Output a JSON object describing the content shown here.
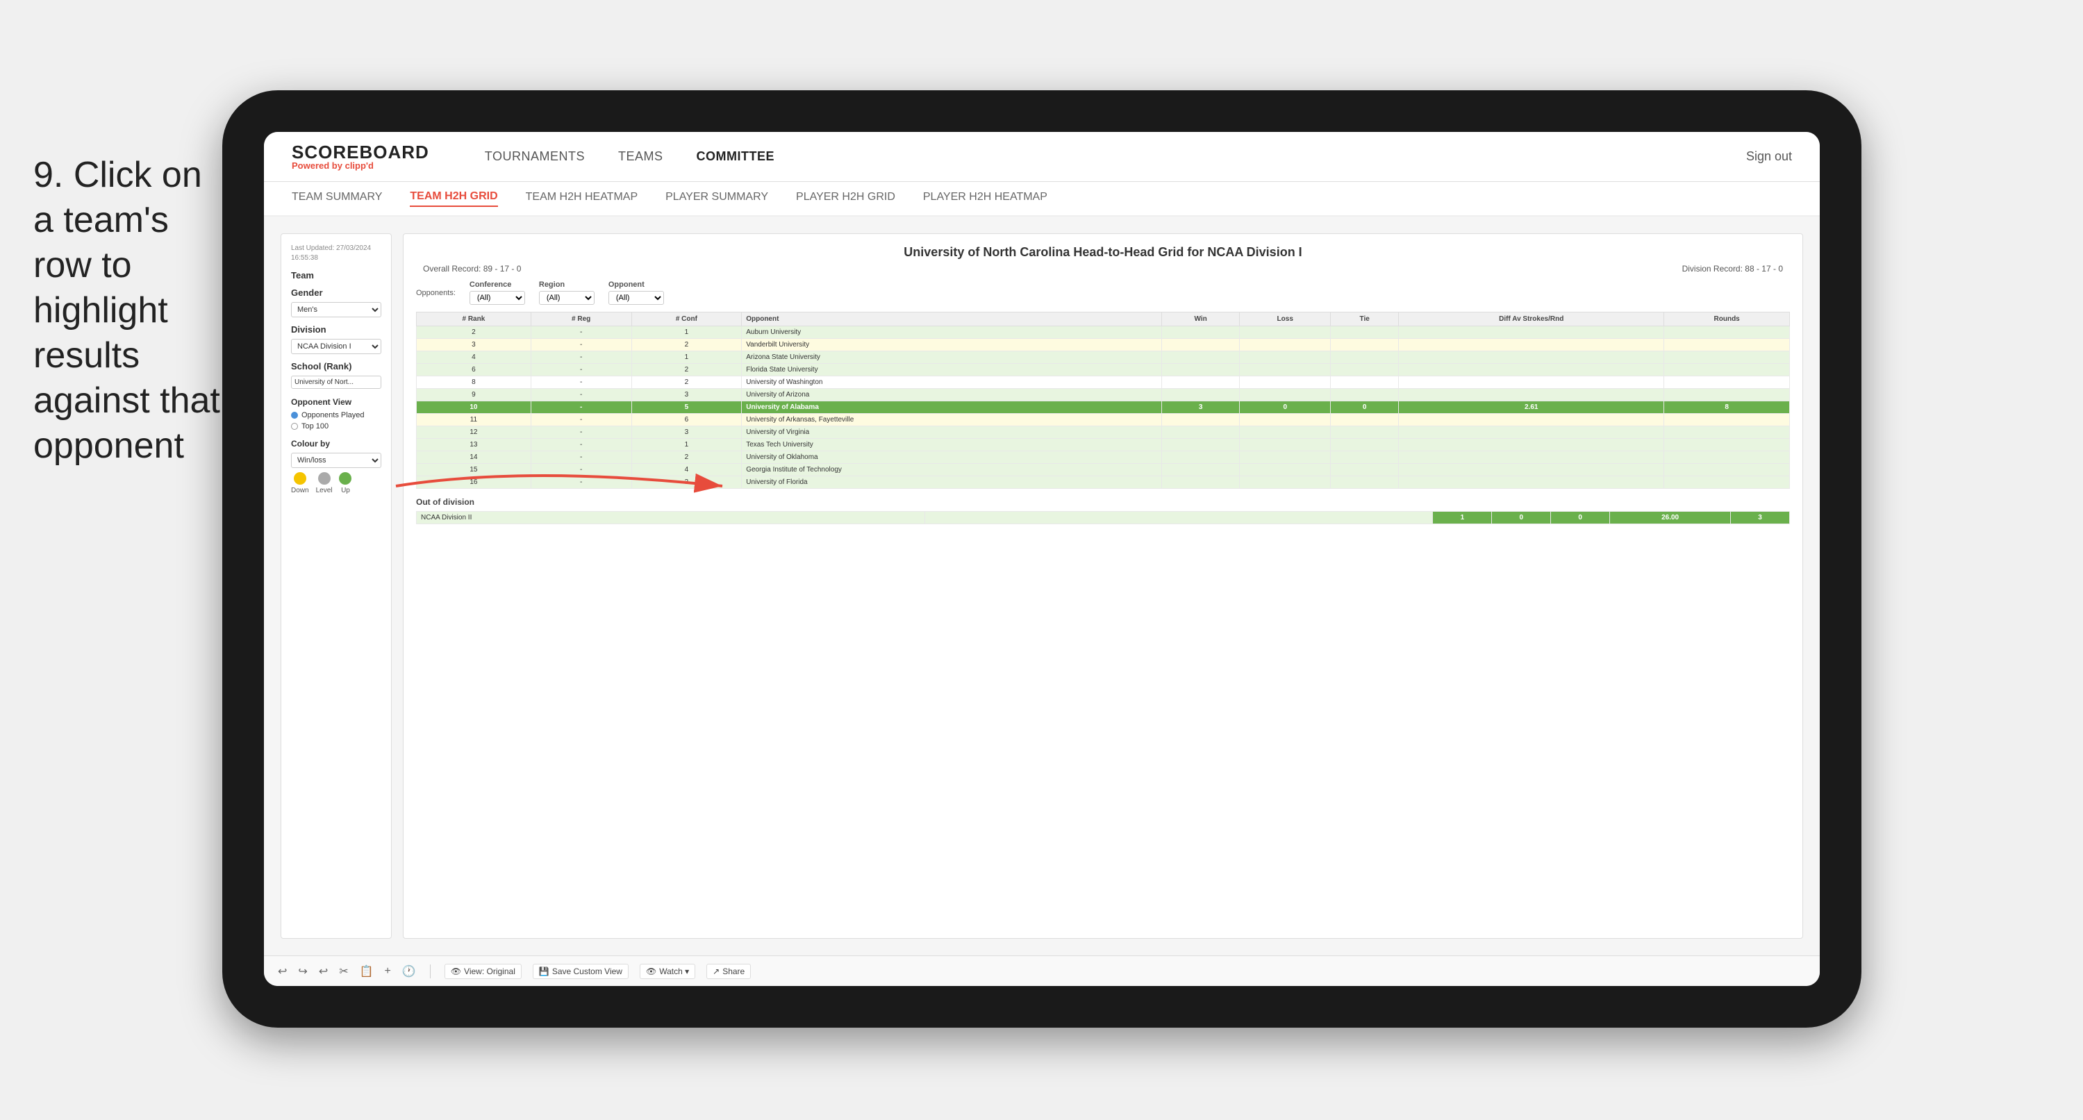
{
  "instruction": {
    "step": "9.",
    "text": "Click on a team's row to highlight results against that opponent"
  },
  "nav": {
    "logo": "SCOREBOARD",
    "powered_by": "Powered by",
    "brand": "clipp'd",
    "links": [
      {
        "label": "TOURNAMENTS",
        "active": false
      },
      {
        "label": "TEAMS",
        "active": false
      },
      {
        "label": "COMMITTEE",
        "active": true
      }
    ],
    "sign_in": "Sign out"
  },
  "sub_nav": {
    "links": [
      {
        "label": "TEAM SUMMARY",
        "active": false
      },
      {
        "label": "TEAM H2H GRID",
        "active": true
      },
      {
        "label": "TEAM H2H HEATMAP",
        "active": false
      },
      {
        "label": "PLAYER SUMMARY",
        "active": false
      },
      {
        "label": "PLAYER H2H GRID",
        "active": false
      },
      {
        "label": "PLAYER H2H HEATMAP",
        "active": false
      }
    ]
  },
  "sidebar": {
    "timestamp_label": "Last Updated: 27/03/2024",
    "timestamp_time": "16:55:38",
    "team_label": "Team",
    "gender_label": "Gender",
    "gender_value": "Men's",
    "division_label": "Division",
    "division_value": "NCAA Division I",
    "school_label": "School (Rank)",
    "school_value": "University of Nort...",
    "opponent_view_label": "Opponent View",
    "radio_opponents": "Opponents Played",
    "radio_top100": "Top 100",
    "colour_by_label": "Colour by",
    "colour_by_value": "Win/loss",
    "legend": [
      {
        "label": "Down",
        "color": "#f5c400"
      },
      {
        "label": "Level",
        "color": "#aaaaaa"
      },
      {
        "label": "Up",
        "color": "#6ab04c"
      }
    ]
  },
  "grid": {
    "title": "University of North Carolina Head-to-Head Grid for NCAA Division I",
    "overall_record_label": "Overall Record:",
    "overall_record": "89 - 17 - 0",
    "division_record_label": "Division Record:",
    "division_record": "88 - 17 - 0",
    "filters": {
      "conference_label": "Conference",
      "conference_value": "(All)",
      "region_label": "Region",
      "region_value": "(All)",
      "opponent_label": "Opponent",
      "opponent_value": "(All)",
      "opponents_label": "Opponents:"
    },
    "columns": [
      "# Rank",
      "# Reg",
      "# Conf",
      "Opponent",
      "Win",
      "Loss",
      "Tie",
      "Diff Av Strokes/Rnd",
      "Rounds"
    ],
    "rows": [
      {
        "rank": "2",
        "reg": "-",
        "conf": "1",
        "opponent": "Auburn University",
        "win": "",
        "loss": "",
        "tie": "",
        "diff": "",
        "rounds": "",
        "style": "light-green"
      },
      {
        "rank": "3",
        "reg": "-",
        "conf": "2",
        "opponent": "Vanderbilt University",
        "win": "",
        "loss": "",
        "tie": "",
        "diff": "",
        "rounds": "",
        "style": "light-yellow"
      },
      {
        "rank": "4",
        "reg": "-",
        "conf": "1",
        "opponent": "Arizona State University",
        "win": "",
        "loss": "",
        "tie": "",
        "diff": "",
        "rounds": "",
        "style": "light-green"
      },
      {
        "rank": "6",
        "reg": "-",
        "conf": "2",
        "opponent": "Florida State University",
        "win": "",
        "loss": "",
        "tie": "",
        "diff": "",
        "rounds": "",
        "style": "light-green"
      },
      {
        "rank": "8",
        "reg": "-",
        "conf": "2",
        "opponent": "University of Washington",
        "win": "",
        "loss": "",
        "tie": "",
        "diff": "",
        "rounds": "",
        "style": "white"
      },
      {
        "rank": "9",
        "reg": "-",
        "conf": "3",
        "opponent": "University of Arizona",
        "win": "",
        "loss": "",
        "tie": "",
        "diff": "",
        "rounds": "",
        "style": "light-green"
      },
      {
        "rank": "10",
        "reg": "-",
        "conf": "5",
        "opponent": "University of Alabama",
        "win": "3",
        "loss": "0",
        "tie": "0",
        "diff": "2.61",
        "rounds": "8",
        "style": "highlighted"
      },
      {
        "rank": "11",
        "reg": "-",
        "conf": "6",
        "opponent": "University of Arkansas, Fayetteville",
        "win": "",
        "loss": "",
        "tie": "",
        "diff": "",
        "rounds": "",
        "style": "light-yellow"
      },
      {
        "rank": "12",
        "reg": "-",
        "conf": "3",
        "opponent": "University of Virginia",
        "win": "",
        "loss": "",
        "tie": "",
        "diff": "",
        "rounds": "",
        "style": "light-green"
      },
      {
        "rank": "13",
        "reg": "-",
        "conf": "1",
        "opponent": "Texas Tech University",
        "win": "",
        "loss": "",
        "tie": "",
        "diff": "",
        "rounds": "",
        "style": "light-green"
      },
      {
        "rank": "14",
        "reg": "-",
        "conf": "2",
        "opponent": "University of Oklahoma",
        "win": "",
        "loss": "",
        "tie": "",
        "diff": "",
        "rounds": "",
        "style": "light-green"
      },
      {
        "rank": "15",
        "reg": "-",
        "conf": "4",
        "opponent": "Georgia Institute of Technology",
        "win": "",
        "loss": "",
        "tie": "",
        "diff": "",
        "rounds": "",
        "style": "light-green"
      },
      {
        "rank": "16",
        "reg": "-",
        "conf": "3",
        "opponent": "University of Florida",
        "win": "",
        "loss": "",
        "tie": "",
        "diff": "",
        "rounds": "",
        "style": "light-green"
      }
    ],
    "out_of_division_label": "Out of division",
    "ood_row": {
      "division": "NCAA Division II",
      "win": "1",
      "loss": "0",
      "tie": "0",
      "diff": "26.00",
      "rounds": "3"
    }
  },
  "toolbar": {
    "view_label": "View: Original",
    "save_label": "Save Custom View",
    "watch_label": "Watch ▾",
    "share_label": "Share"
  }
}
